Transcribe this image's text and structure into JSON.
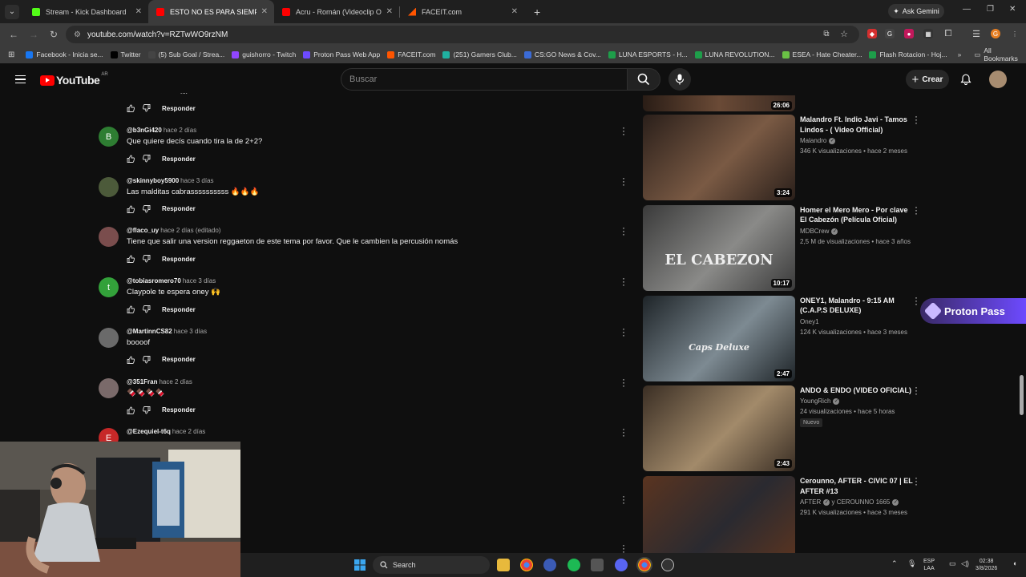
{
  "browser": {
    "tabs": [
      {
        "label": "Stream - Kick Dashboard",
        "color": "#53fc18"
      },
      {
        "label": "ESTO NO ES PARA SIEMPRE - C",
        "color": "#ff0000",
        "active": true
      },
      {
        "label": "Acru - Román (Videoclip Oficial",
        "color": "#ff0000"
      },
      {
        "label": "FACEIT.com",
        "color": "#ff5500"
      }
    ],
    "ask_gemini": "Ask Gemini",
    "url": "youtube.com/watch?v=RZTwWO9rzNM",
    "bookmarks": [
      {
        "label": "Facebook - Inicia se...",
        "color": "#1877f2"
      },
      {
        "label": "Twitter",
        "color": "#000000"
      },
      {
        "label": "(5) Sub Goal / Strea...",
        "color": "#444"
      },
      {
        "label": "guishorro - Twitch",
        "color": "#9146ff"
      },
      {
        "label": "Proton Pass Web App",
        "color": "#6d4aff"
      },
      {
        "label": "FACEIT.com",
        "color": "#ff5500"
      },
      {
        "label": "(251) Gamers Club...",
        "color": "#1fb0a0"
      },
      {
        "label": "CS:GO News & Cov...",
        "color": "#3b6bd6"
      },
      {
        "label": "LUNA ESPORTS - H...",
        "color": "#1e9e4a"
      },
      {
        "label": "LUNA REVOLUTION...",
        "color": "#1e9e4a"
      },
      {
        "label": "ESEA - Hate Cheater...",
        "color": "#6ac045"
      },
      {
        "label": "Flash Rotacion - Hoj...",
        "color": "#1e9e4a"
      }
    ],
    "all_bookmarks": "All Bookmarks"
  },
  "youtube": {
    "logo": "YouTube",
    "country": "AR",
    "search_placeholder": "Buscar",
    "create_label": "Crear",
    "reply_label": "Responder",
    "top_fragment": "....",
    "comments": [
      {
        "handle": "@b3nGi420",
        "time": "hace 2 días",
        "text": "Que quiere decís cuando tira la de 2+2?",
        "initial": "B",
        "color": "#2e7d32"
      },
      {
        "handle": "@skinnyboy5900",
        "time": "hace 3 días",
        "text": "Las  malditas cabrassssssssss 🔥🔥🔥",
        "initial": "",
        "color": "#4c5a3a"
      },
      {
        "handle": "@flaco_uy",
        "time": "hace 2 días (editado)",
        "text": "Tiene que salir una version reggaeton de este tema por favor. Que le cambien la percusión nomás",
        "initial": "",
        "color": "#7a4d4d"
      },
      {
        "handle": "@tobiasromero70",
        "time": "hace 3 días",
        "text": "Claypole te espera oney 🙌",
        "initial": "t",
        "color": "#33a13a"
      },
      {
        "handle": "@MartinnCS82",
        "time": "hace 3 días",
        "text": "boooof",
        "initial": "",
        "color": "#6a6a6a"
      },
      {
        "handle": "@351Fran",
        "time": "hace 2 días",
        "text": "🍫🍫🍫🍫",
        "initial": "",
        "color": "#7a6a6a"
      },
      {
        "handle": "@Ezequiel-t6q",
        "time": "hace 2 días",
        "text": "",
        "initial": "E",
        "color": "#c62828"
      }
    ],
    "top_duration": "26:06",
    "related": [
      {
        "title": "Malandro  Ft. Indio Javi - Tamos Lindos - ( Video Official)",
        "channel": "Malandro",
        "verified": true,
        "stats": "346 K visualizaciones • hace 2 meses",
        "duration": "3:24",
        "colors": [
          "#2a1f1a",
          "#7a5a44"
        ]
      },
      {
        "title": "Homer el Mero Mero - Por clave El Cabezón (Película Oficial)",
        "channel": "MDBCrew",
        "verified": true,
        "stats": "2,5 M de visualizaciones • hace 3 años",
        "duration": "10:17",
        "colors": [
          "#3a3a3a",
          "#8a8a88"
        ],
        "overlay": "EL CABEZON"
      },
      {
        "title": "ONEY1, Malandro - 9:15 AM (C.A.P.S DELUXE)",
        "channel": "Oney1",
        "verified": false,
        "stats": "124 K visualizaciones • hace 3 meses",
        "duration": "2:47",
        "colors": [
          "#1e2428",
          "#7d8a92"
        ],
        "overlay": "Caps Deluxe"
      },
      {
        "title": "ANDO & ENDO (VIDEO OFICIAL)",
        "channel": "YoungRich",
        "verified": true,
        "stats": "24 visualizaciones • hace 5 horas",
        "duration": "2:43",
        "colors": [
          "#3a2e24",
          "#a28a6a"
        ],
        "badge": "Nuevo"
      },
      {
        "title": "Cerounno, AFTER - CIVIC 07 | EL AFTER #13",
        "channel": "AFTER",
        "channel_extra": "y CEROUNNO 1665",
        "verified": true,
        "stats": "291 K visualizaciones • hace 3 meses",
        "duration": "",
        "colors": [
          "#5a3420",
          "#2a2a30"
        ]
      }
    ]
  },
  "overlay": {
    "proton_pass": "Proton Pass"
  },
  "taskbar": {
    "search": "Search",
    "lang_top": "ESP",
    "lang_bottom": "LAA",
    "time": "02:38",
    "date": "3/8/2026"
  }
}
